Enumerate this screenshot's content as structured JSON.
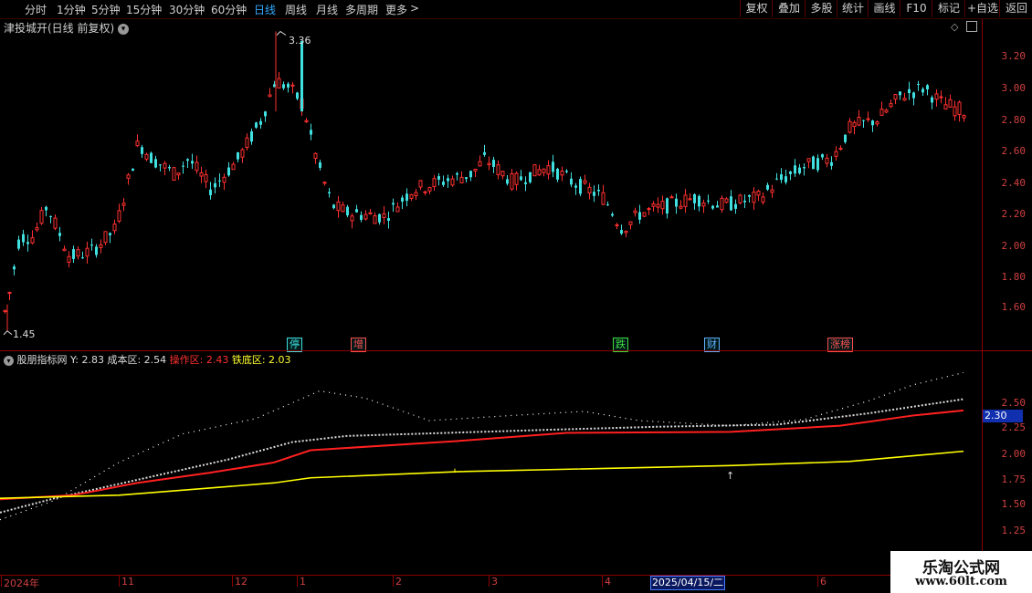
{
  "toolbar": {
    "periods": [
      {
        "label": "分时",
        "active": false
      },
      {
        "label": "1分钟",
        "active": false
      },
      {
        "label": "5分钟",
        "active": false
      },
      {
        "label": "15分钟",
        "active": false
      },
      {
        "label": "30分钟",
        "active": false
      },
      {
        "label": "60分钟",
        "active": false
      },
      {
        "label": "日线",
        "active": true
      },
      {
        "label": "周线",
        "active": false
      },
      {
        "label": "月线",
        "active": false
      },
      {
        "label": "多周期",
        "active": false
      },
      {
        "label": "更多",
        "active": false
      }
    ],
    "buttons": [
      "复权",
      "叠加",
      "多股",
      "统计",
      "画线",
      "F10",
      "标记",
      "+自选",
      "返回"
    ]
  },
  "main_panel": {
    "title": "津投城开(日线 前复权)",
    "y_labels": [
      "3.20",
      "3.00",
      "2.80",
      "2.60",
      "2.40",
      "2.20",
      "2.00",
      "1.80",
      "1.60"
    ],
    "high_label": "3.36",
    "low_label": "1.45",
    "tags": [
      {
        "text": "停",
        "color": "#40e0e0"
      },
      {
        "text": "增",
        "color": "#ff5050"
      },
      {
        "text": "跌",
        "color": "#40e040"
      },
      {
        "text": "财",
        "color": "#60b0ff"
      },
      {
        "text": "涨榜",
        "color": "#ff5050"
      }
    ]
  },
  "indicator_panel": {
    "name": "股朋指标网",
    "y_value": "Y: 2.83",
    "cost_label": "成本区: 2.54",
    "op_label": "操作区: 2.43",
    "floor_label": "铁底区: 2.03",
    "y_labels": [
      "2.50",
      "2.25",
      "2.00",
      "1.75",
      "1.50",
      "1.25"
    ],
    "current_value": "2.30"
  },
  "x_axis": {
    "labels": [
      "2024年",
      "11",
      "12",
      "1",
      "2",
      "3",
      "4",
      "6"
    ],
    "selected_date": "2025/04/15/二"
  },
  "watermark": {
    "line1": "乐淘公式网",
    "line2": "www.60lt.com"
  },
  "chart_data": {
    "type": "candlestick",
    "price_range": [
      1.45,
      3.36
    ],
    "indicator_series": [
      {
        "name": "成本区",
        "color": "#ffffff",
        "style": "dotted-diamond",
        "last": 2.54
      },
      {
        "name": "操作区",
        "color": "#ff2020",
        "style": "solid",
        "last": 2.43
      },
      {
        "name": "铁底区",
        "color": "#ffff00",
        "style": "solid",
        "last": 2.03
      }
    ],
    "colors": {
      "up": "#ff3030",
      "down": "#40e0e0"
    }
  }
}
